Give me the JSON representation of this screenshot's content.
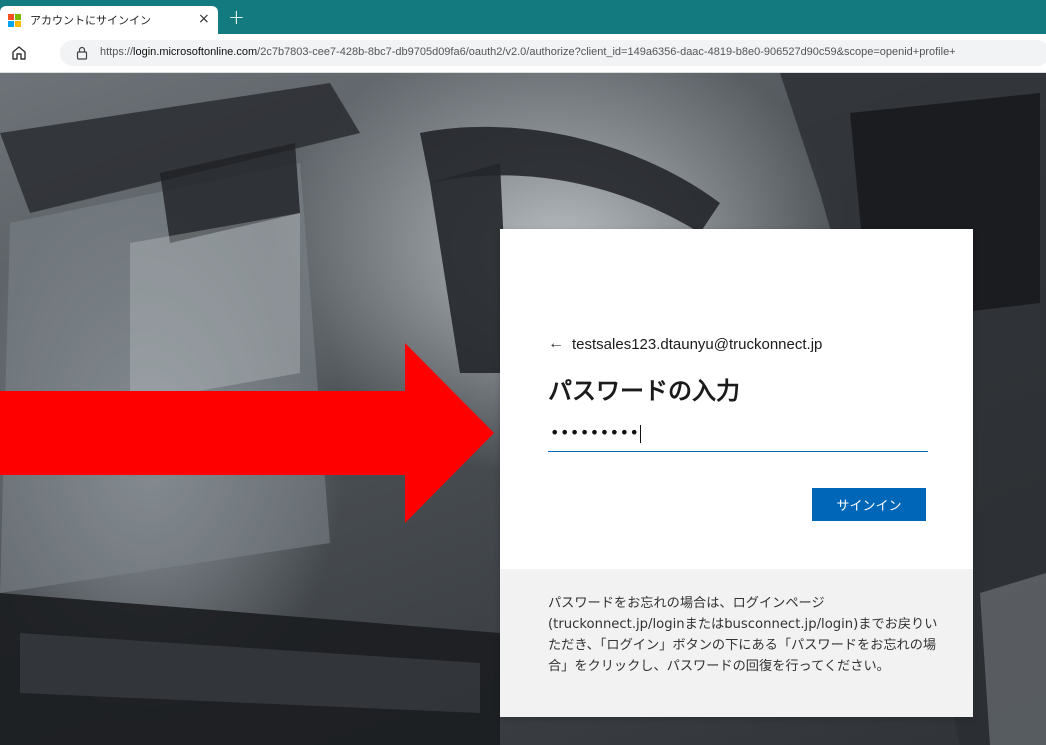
{
  "browser": {
    "tab_title": "アカウントにサインイン",
    "tab_close": "×",
    "new_tab": "+",
    "url_scheme": "https://",
    "url_host": "login.microsoftonline.com",
    "url_path": "/2c7b7803-cee7-428b-8bc7-db9705d09fa6/oauth2/v2.0/authorize?client_id=149a6356-daac-4819-b8e0-906527d90c59&scope=openid+profile+"
  },
  "signin": {
    "back_arrow": "←",
    "account": "testsales123.dtaunyu@truckonnect.jp",
    "title": "パスワードの入力",
    "password_masked": "•••••••••",
    "signin_label": "サインイン"
  },
  "note": {
    "text": "パスワードをお忘れの場合は、ログインページ(truckonnect.jp/loginまたはbusconnect.jp/login)までお戻りいただき、「ログイン」ボタンの下にある「パスワードをお忘れの場合」をクリックし、パスワードの回復を行ってください。"
  },
  "colors": {
    "tabstrip": "#137a7f",
    "accent": "#0067b8",
    "arrow": "#ff0000"
  },
  "icons": [
    "microsoft-logo-icon",
    "close-icon",
    "plus-icon",
    "home-icon",
    "lock-icon",
    "back-arrow-icon",
    "red-arrow-annotation"
  ]
}
